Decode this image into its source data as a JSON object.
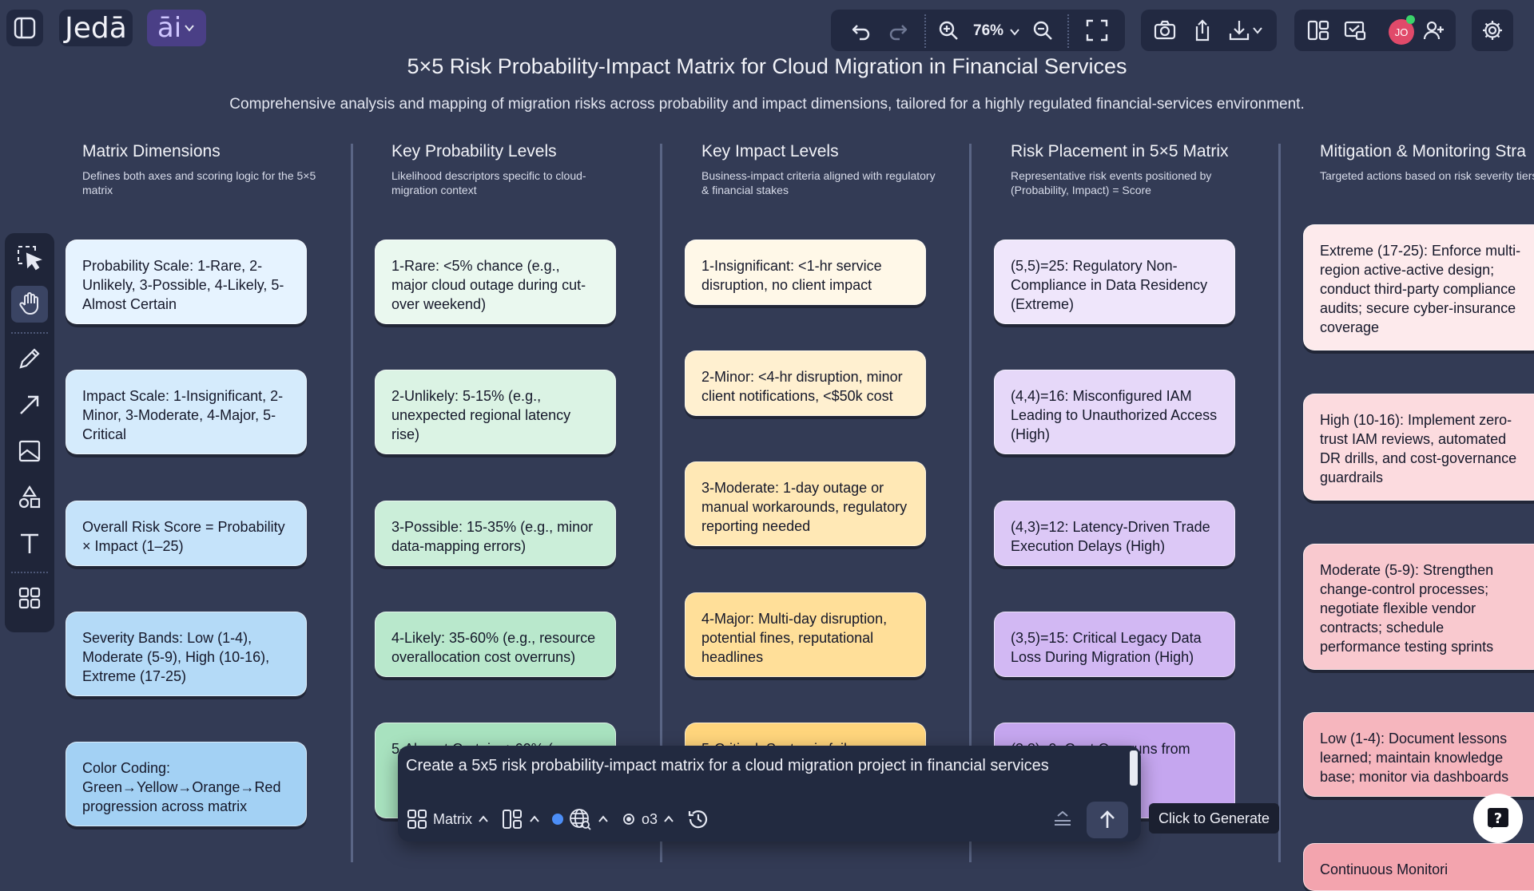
{
  "app": {
    "logo_text": "Jedā",
    "ai_label": "āi"
  },
  "toolbar": {
    "zoom": "76%"
  },
  "user": {
    "initials": "JO"
  },
  "header": {
    "title": "5×5 Risk Probability-Impact Matrix for Cloud Migration in Financial Services",
    "subtitle": "Comprehensive analysis and mapping of migration risks across probability and impact dimensions, tailored for a highly regulated financial-services environment."
  },
  "columns": [
    {
      "title": "Matrix Dimensions",
      "desc": "Defines both axes and scoring logic for the 5×5 matrix",
      "cards": [
        "Probability Scale: 1-Rare, 2-Unlikely, 3-Possible, 4-Likely, 5-Almost Certain",
        "Impact Scale: 1-Insignificant, 2-Minor, 3-Moderate, 4-Major, 5-Critical",
        "Overall Risk Score = Probability × Impact (1–25)",
        "Severity Bands: Low (1-4), Moderate (5-9), High (10-16), Extreme (17-25)",
        "Color Coding: Green→Yellow→Orange→Red progression across matrix"
      ]
    },
    {
      "title": "Key Probability Levels",
      "desc": "Likelihood descriptors specific to cloud-migration context",
      "cards": [
        "1-Rare: <5% chance (e.g., major cloud outage during cut-over weekend)",
        "2-Unlikely: 5-15% (e.g., unexpected regional latency rise)",
        "3-Possible: 15-35% (e.g., minor data-mapping errors)",
        "4-Likely: 35-60% (e.g., resource overallocation cost overruns)",
        "5-Almost Certain: >60% (e.g.,"
      ]
    },
    {
      "title": "Key Impact Levels",
      "desc": "Business-impact criteria aligned with regulatory & financial stakes",
      "cards": [
        "1-Insignificant: <1-hr service disruption, no client impact",
        "2-Minor: <4-hr disruption, minor client notifications, <$50k cost",
        "3-Moderate: 1-day outage or manual workarounds, regulatory reporting needed",
        "4-Major: Multi-day disruption, potential fines, reputational headlines",
        "5-Critical: Systemic failure"
      ]
    },
    {
      "title": "Risk Placement in 5×5 Matrix",
      "desc": "Representative risk events positioned by (Probability, Impact) = Score",
      "cards": [
        "(5,5)=25: Regulatory Non-Compliance in Data Residency (Extreme)",
        "(4,4)=16: Misconfigured IAM Leading to Unauthorized Access (High)",
        "(4,3)=12: Latency-Driven Trade Execution Delays (High)",
        "(3,5)=15: Critical Legacy Data Loss During Migration (High)",
        "(3,3)=9: Cost Overruns from Fees"
      ]
    },
    {
      "title": "Mitigation & Monitoring Stra",
      "desc": "Targeted actions based on risk severity tiers",
      "cards": [
        "Extreme (17-25): Enforce multi-region active-active design; conduct third-party compliance audits; secure cyber-insurance coverage",
        "High (10-16): Implement zero-trust IAM reviews, automated DR drills, and cost-governance guardrails",
        "Moderate (5-9): Strengthen change-control processes; negotiate flexible vendor contracts; schedule performance testing sprints",
        "Low (1-4): Document lessons learned; maintain knowledge base; monitor via dashboards",
        "Continuous Monitori"
      ]
    }
  ],
  "prompt": {
    "text": "Create a 5x5 risk probability-impact matrix for a cloud migration project in financial services",
    "mode": "Matrix",
    "model": "o3",
    "tooltip": "Click to Generate"
  },
  "colors": {
    "background": "#333b55",
    "blue_cards": [
      "#e6f3ff",
      "#d5ebfc",
      "#c5e3fa",
      "#b4daf7",
      "#a3d1f4"
    ],
    "green_cards": [
      "#eaf8ef",
      "#dbf3e4",
      "#cbeed9",
      "#b9e8cc",
      "#a8e2bf"
    ],
    "yellow_cards": [
      "#fff8e8",
      "#fff0d0",
      "#ffe8b5",
      "#ffdf99",
      "#ffd57c"
    ],
    "purple_cards": [
      "#efe6fb",
      "#e6d8f9",
      "#dcc8f6",
      "#d2b8f3",
      "#c5a6ef"
    ],
    "red_cards": [
      "#fdeaec",
      "#fcdbdf",
      "#f9c9cf",
      "#f6b6be",
      "#f3a4ae"
    ]
  }
}
